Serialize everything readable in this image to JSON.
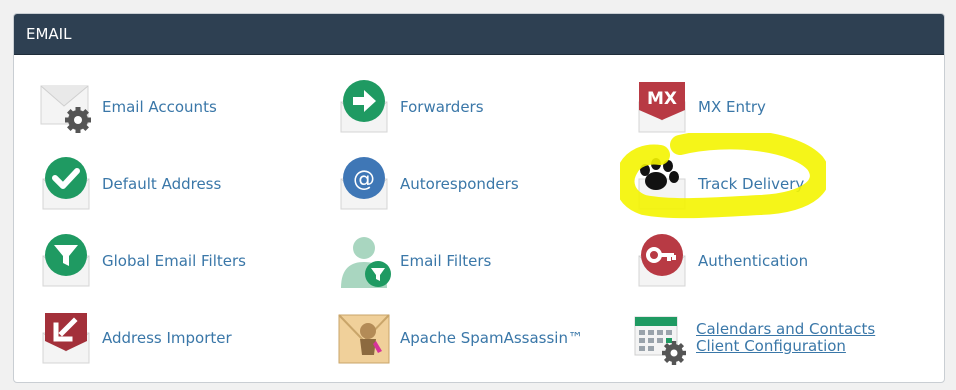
{
  "section": {
    "title": "EMAIL"
  },
  "items": [
    {
      "label": "Email Accounts"
    },
    {
      "label": "Forwarders"
    },
    {
      "label": "MX Entry",
      "icon_text": "MX"
    },
    {
      "label": "Default Address"
    },
    {
      "label": "Autoresponders",
      "icon_text": "@"
    },
    {
      "label": "Track Delivery"
    },
    {
      "label": "Global Email Filters"
    },
    {
      "label": "Email Filters"
    },
    {
      "label": "Authentication"
    },
    {
      "label": "Address Importer"
    },
    {
      "label": "Apache SpamAssassin™"
    },
    {
      "label_line1": "Calendars and Contacts",
      "label_line2": "Client Configuration"
    }
  ],
  "colors": {
    "header_bg": "#2e4052",
    "link": "#3a77a8",
    "green": "#1f9a62",
    "red": "#b83a44",
    "blue": "#3f77b6",
    "highlight": "#f4f400"
  }
}
